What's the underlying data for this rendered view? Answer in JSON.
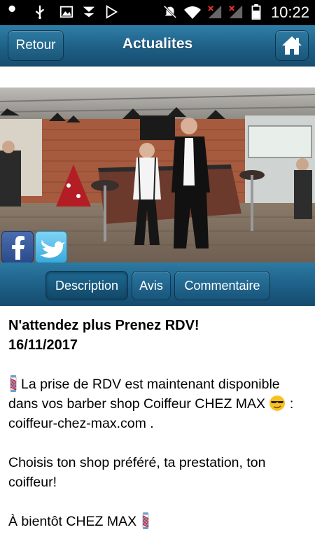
{
  "status_bar": {
    "time": "10:22",
    "icons": [
      "wrench-icon",
      "usb-icon",
      "image-icon",
      "download-icon",
      "play-store-icon",
      "mute-icon",
      "wifi-icon",
      "signal-icon",
      "signal-icon",
      "battery-icon"
    ]
  },
  "header": {
    "back_label": "Retour",
    "title": "Actualites",
    "home_icon": "home-icon"
  },
  "social": {
    "facebook_icon": "facebook-icon",
    "twitter_icon": "twitter-icon"
  },
  "tabs": [
    {
      "label": "Description",
      "active": true
    },
    {
      "label": "Avis",
      "active": false
    },
    {
      "label": "Commentaire",
      "active": false
    }
  ],
  "article": {
    "headline": "N'attendez plus Prenez RDV!",
    "date": "16/11/2017",
    "paragraph1_a": "La prise de RDV est maintenant disponible dans vos barber shop Coiffeur CHEZ MAX",
    "paragraph1_b": ":",
    "paragraph1_c": "coiffeur-chez-max.com .",
    "paragraph2": "Choisis ton shop préféré, ta prestation, ton coiffeur!",
    "paragraph3": "À bientôt CHEZ MAX"
  },
  "colors": {
    "bar_blue": "#1e5f86",
    "status_bg": "#000000"
  }
}
